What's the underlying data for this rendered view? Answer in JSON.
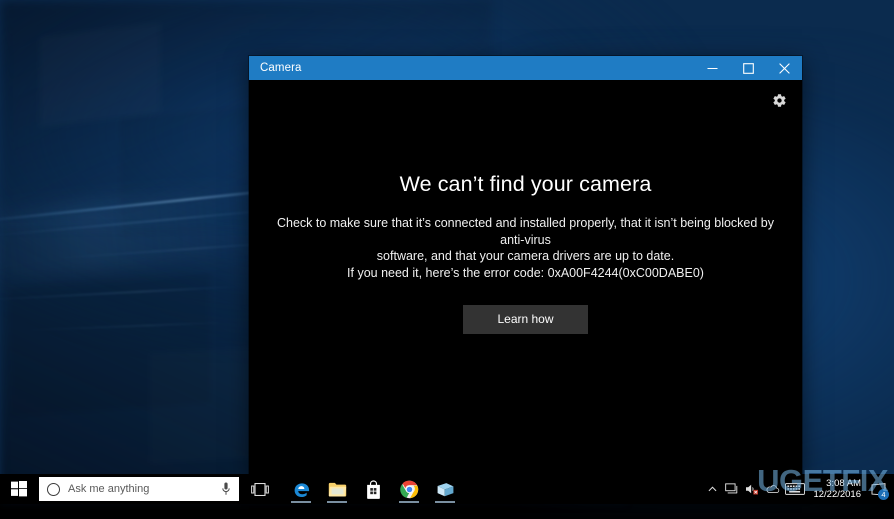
{
  "desktop": {
    "wallpaper_name": "windows-10-hero-wallpaper",
    "colors": {
      "wallpaper_base": "#0b2b4e",
      "wallpaper_highlight": "#17548f",
      "accent_blue": "#1f7cc4"
    }
  },
  "camera_window": {
    "title": "Camera",
    "controls": {
      "minimize_label": "Minimize",
      "maximize_label": "Maximize",
      "close_label": "Close"
    },
    "settings_icon_name": "gear-icon",
    "error": {
      "heading": "We can’t find your camera",
      "description_line1": "Check to make sure that it’s connected and installed properly, that it isn’t being blocked by anti-virus",
      "description_line2": "software, and that your camera drivers are up to date.",
      "code_line": "If you need it, here’s the error code: 0xA00F4244(0xC00DABE0)",
      "error_code": "0xA00F4244(0xC00DABE0)"
    },
    "learn_how_button": "Learn how"
  },
  "taskbar": {
    "start_button_label": "Start",
    "search": {
      "placeholder": "Ask me anything",
      "value": "",
      "mic_icon_name": "microphone-icon",
      "cortana_icon_name": "cortana-circle-icon"
    },
    "task_view_label": "Task View",
    "pinned_apps": [
      {
        "name": "Microsoft Edge",
        "icon": "edge-icon",
        "running": true
      },
      {
        "name": "File Explorer",
        "icon": "folder-icon",
        "running": true
      },
      {
        "name": "Microsoft Store",
        "icon": "store-icon",
        "running": false
      },
      {
        "name": "Google Chrome",
        "icon": "chrome-icon",
        "running": true
      },
      {
        "name": "Camera",
        "icon": "camera-app-icon",
        "running": true
      }
    ],
    "tray": {
      "show_hidden_icons_label": "Show hidden icons",
      "network_icon_name": "network-icon",
      "volume_icon_name": "volume-muted-icon",
      "onedrive_icon_name": "onedrive-icon",
      "keyboard_icon_name": "keyboard-icon",
      "time": "3:08 AM",
      "date": "12/22/2016",
      "action_center_icon_name": "action-center-icon",
      "action_center_badge": "4"
    }
  },
  "watermark": {
    "text": "UGETFIX"
  }
}
